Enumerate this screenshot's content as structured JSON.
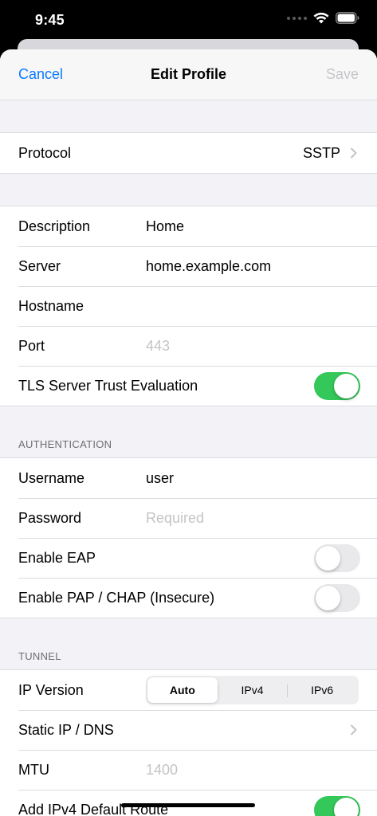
{
  "status_bar": {
    "time": "9:45",
    "icons": [
      "signal-icon",
      "wifi-icon",
      "battery-icon"
    ]
  },
  "nav": {
    "cancel": "Cancel",
    "title": "Edit Profile",
    "save": "Save"
  },
  "protocol": {
    "label": "Protocol",
    "value": "SSTP"
  },
  "server_section": {
    "description": {
      "label": "Description",
      "value": "Home"
    },
    "server": {
      "label": "Server",
      "value": "home.example.com"
    },
    "hostname": {
      "label": "Hostname",
      "value": ""
    },
    "port": {
      "label": "Port",
      "placeholder": "443"
    },
    "tls": {
      "label": "TLS Server Trust Evaluation",
      "on": true
    }
  },
  "authentication": {
    "header": "AUTHENTICATION",
    "username": {
      "label": "Username",
      "value": "user"
    },
    "password": {
      "label": "Password",
      "placeholder": "Required"
    },
    "eap": {
      "label": "Enable EAP",
      "on": false
    },
    "pap_chap": {
      "label": "Enable PAP / CHAP (Insecure)",
      "on": false
    }
  },
  "tunnel": {
    "header": "TUNNEL",
    "ip_version": {
      "label": "IP Version",
      "options": [
        "Auto",
        "IPv4",
        "IPv6"
      ],
      "selected": "Auto"
    },
    "static_ip": {
      "label": "Static IP / DNS"
    },
    "mtu": {
      "label": "MTU",
      "placeholder": "1400"
    },
    "ipv4_default_route": {
      "label": "Add IPv4 Default Route",
      "on": true
    }
  },
  "colors": {
    "accent": "#0a7aff",
    "toggle_on": "#34c759",
    "disabled": "#c6c6ca"
  }
}
